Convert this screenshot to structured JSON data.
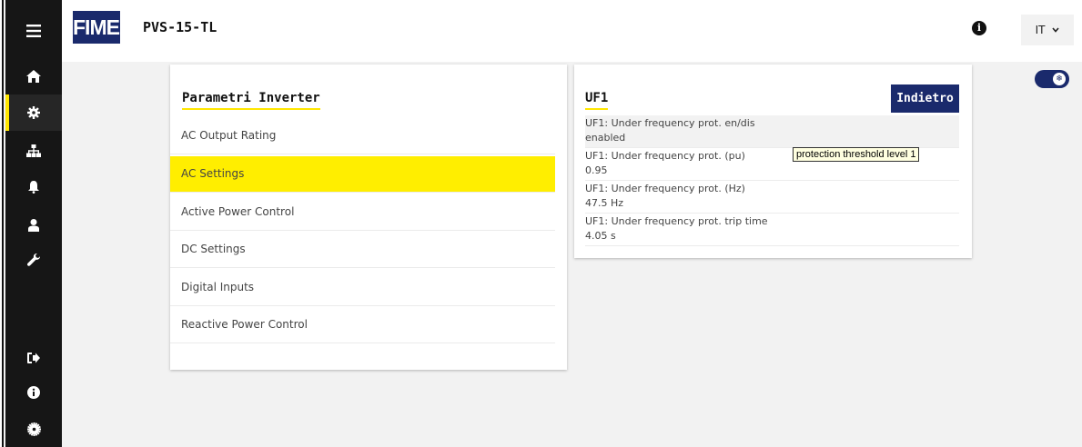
{
  "header": {
    "logo_text": "FIMER",
    "device_name": "PVS-15-TL",
    "info_icon": "info-circle-icon",
    "language": "IT",
    "language_chevron_icon": "chevron-down-icon"
  },
  "sidebar": {
    "menu_icon": "hamburger-menu-icon",
    "items": [
      {
        "icon": "home-icon",
        "active": false
      },
      {
        "icon": "gear-icon",
        "active": true
      },
      {
        "icon": "network-icon",
        "active": false
      },
      {
        "icon": "bell-icon",
        "active": false
      },
      {
        "icon": "user-icon",
        "active": false
      },
      {
        "icon": "wrench-icon",
        "active": false
      }
    ],
    "bottom_items": [
      {
        "icon": "logout-icon"
      },
      {
        "icon": "info-icon"
      },
      {
        "icon": "settings-cog-icon"
      }
    ]
  },
  "toggle": {
    "state": "on",
    "icon": "snowflake-icon",
    "accent": "#1a2a6c"
  },
  "left_panel": {
    "title": "Parametri Inverter",
    "items": [
      {
        "label": "AC Output Rating"
      },
      {
        "label": "AC Settings"
      },
      {
        "label": "Active Power Control"
      },
      {
        "label": "DC Settings"
      },
      {
        "label": "Digital Inputs"
      },
      {
        "label": "Reactive Power Control"
      }
    ],
    "active_index": 1
  },
  "right_panel": {
    "title": "UF1",
    "back_button": "Indietro",
    "params": [
      {
        "label": "UF1: Under frequency prot. en/dis",
        "value": "enabled"
      },
      {
        "label": "UF1: Under frequency prot. (pu)",
        "value": "0.95"
      },
      {
        "label": "UF1: Under frequency prot. (Hz)",
        "value": "47.5 Hz"
      },
      {
        "label": "UF1: Under frequency prot. trip time",
        "value": "4.05 s"
      }
    ]
  },
  "tooltip": "protection threshold level 1",
  "colors": {
    "accent_yellow": "#ffee00",
    "brand_navy": "#1a2a6c",
    "sidebar_bg": "#161616"
  }
}
